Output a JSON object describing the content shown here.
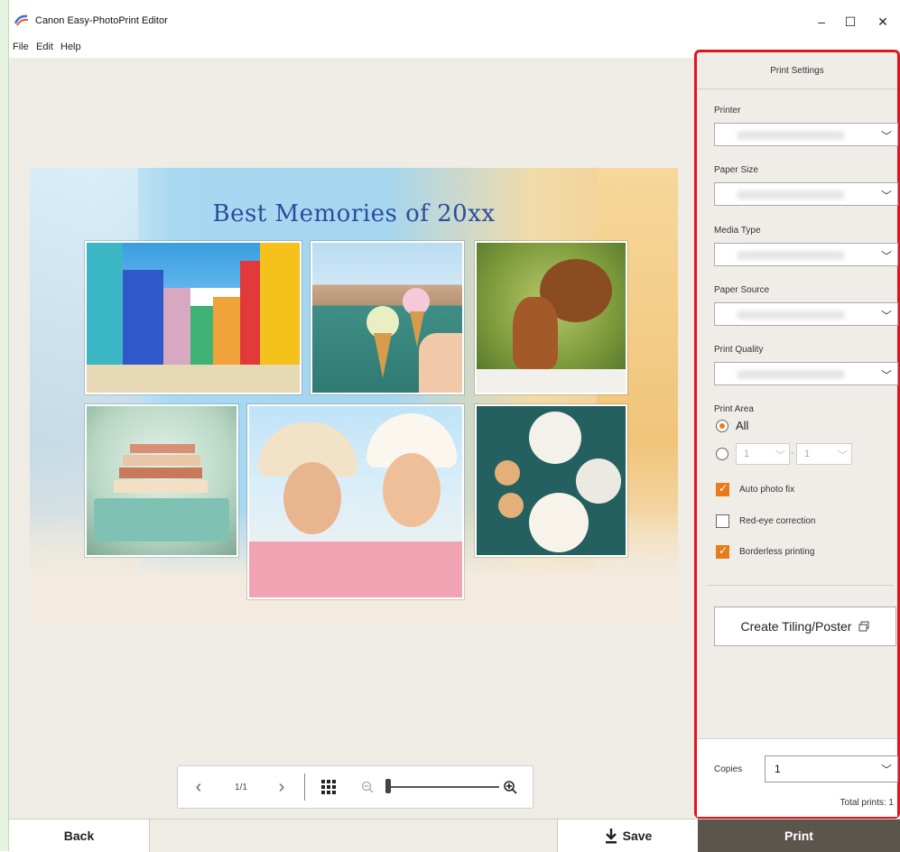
{
  "window": {
    "title": "Canon Easy-PhotoPrint Editor",
    "minimize": "–",
    "maximize": "☐",
    "close": "✕"
  },
  "menu": {
    "items": [
      "File",
      "Edit",
      "Help"
    ]
  },
  "poster": {
    "title": "Best Memories of 20xx"
  },
  "page_nav": {
    "page_indicator": "1/1",
    "zoom_level": 0.0
  },
  "print_settings": {
    "header": "Print Settings",
    "printer_label": "Printer",
    "paper_size_label": "Paper Size",
    "media_type_label": "Media Type",
    "paper_source_label": "Paper Source",
    "print_quality_label": "Print Quality",
    "print_area_label": "Print Area",
    "print_area_all": "All",
    "range_from": "1",
    "range_sep": "-",
    "range_to": "1",
    "auto_photo_fix": "Auto photo fix",
    "red_eye": "Red-eye correction",
    "borderless": "Borderless printing",
    "auto_photo_fix_checked": true,
    "red_eye_checked": false,
    "borderless_checked": true,
    "tiling_button": "Create Tiling/Poster",
    "copies_label": "Copies",
    "copies_value": "1",
    "total_prints": "Total prints: 1"
  },
  "bottom": {
    "back": "Back",
    "save": "Save",
    "print": "Print"
  },
  "colors": {
    "accent": "#e97b1a",
    "highlight_border": "#e0161d",
    "print_button": "#5c554d"
  }
}
